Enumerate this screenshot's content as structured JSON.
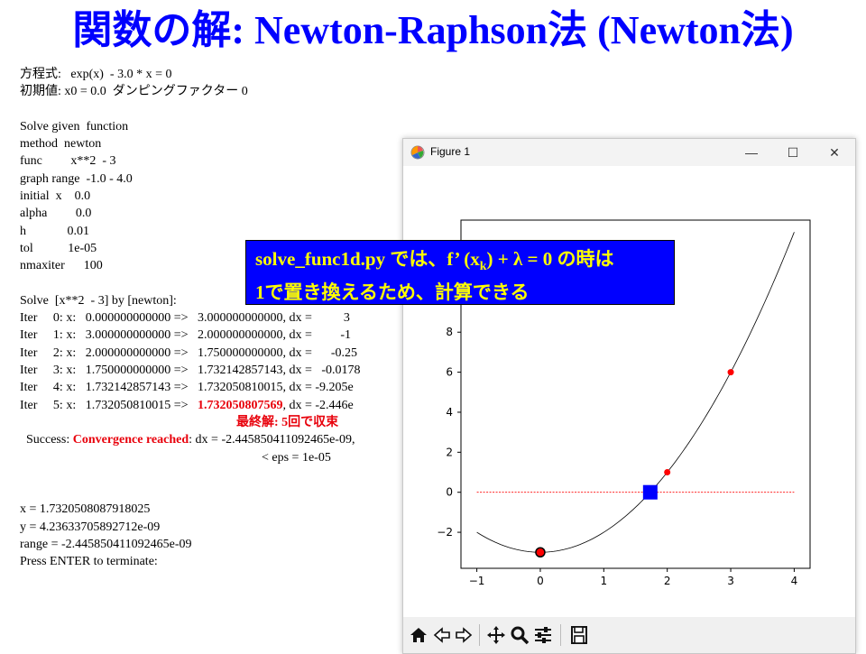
{
  "slide": {
    "title": "関数の解: Newton-Raphson法 (Newton法)"
  },
  "console": {
    "lines": [
      "方程式:   exp(x)  - 3.0 * x = 0",
      "初期値: x0 = 0.0  ダンピングファクター 0",
      "",
      "Solve given  function",
      "method  newton",
      "func         x**2  - 3",
      "graph range  -1.0 - 4.0",
      "initial  x    0.0",
      "alpha         0.0",
      "h             0.01",
      "tol           1e-05",
      "nmaxiter      100",
      "",
      "Solve  [x**2  - 3] by [newton]:",
      "Iter     0: x:   0.000000000000 =>   3.000000000000, dx =          3",
      "Iter     1: x:   3.000000000000 =>   2.000000000000, dx =         -1",
      "Iter     2: x:   2.000000000000 =>   1.750000000000, dx =      -0.25",
      "Iter     3: x:   1.750000000000 =>   1.732142857143, dx =   -0.0178",
      "Iter     4: x:   1.732142857143 =>   1.732050810015, dx = -9.205e",
      "Iter     5: x:   1.732050810015 =>   "
    ],
    "iter5_value": "1.732050807569",
    "iter5_rest": ", dx = -2.446e",
    "final_note": "最終解: 5回で収束",
    "success_prefix": "  Success: ",
    "success_status": "Convergence reached",
    "success_rest": ": dx = -2.445850411092465e-09,",
    "eps_line": "< eps = 1e-05",
    "result_lines": [
      "x = 1.7320508087918025",
      "y = 4.23633705892712e-09",
      "range = -2.445850411092465e-09",
      "Press ENTER to terminate:"
    ]
  },
  "callout": {
    "line1": "solve_func1d.py では、f’ (x",
    "line1_sub": "k",
    "line1_end": ") + λ = 0 の時は",
    "line2": "1で置き換えるため、計算できる"
  },
  "figure_window": {
    "title": "Figure 1",
    "minimize": "—",
    "maximize": "☐",
    "close": "✕",
    "toolbar_icons": [
      "home-icon",
      "back-icon",
      "forward-icon",
      "pan-icon",
      "zoom-icon",
      "configure-icon",
      "save-icon"
    ]
  },
  "chart_data": {
    "type": "line",
    "curve": {
      "expr": "x**2 - 3",
      "x_range": [
        -1.0,
        4.0
      ],
      "color": "#000000"
    },
    "zero_line": {
      "y": 0,
      "x_range": [
        -1.0,
        4.0
      ],
      "color": "#ff0000",
      "style": "dashed"
    },
    "iterates": {
      "x": [
        2,
        3
      ],
      "y": [
        1,
        6
      ],
      "color": "#ff0000"
    },
    "initial_point": {
      "x": 0,
      "y": -3,
      "color": "#ff0000"
    },
    "solution_point": {
      "x": 1.7320508087918025,
      "y": 0,
      "color": "#0000ff"
    },
    "xlim": [
      -1.25,
      4.25
    ],
    "ylim": [
      -3.8,
      13.6
    ],
    "xticks": [
      -1,
      0,
      1,
      2,
      3,
      4
    ],
    "yticks": [
      -2,
      0,
      2,
      4,
      6,
      8
    ],
    "xtick_labels": [
      "−1",
      "0",
      "1",
      "2",
      "3",
      "4"
    ],
    "ytick_labels": [
      "−2",
      "0",
      "2",
      "4",
      "6",
      "8"
    ],
    "grid": false
  }
}
